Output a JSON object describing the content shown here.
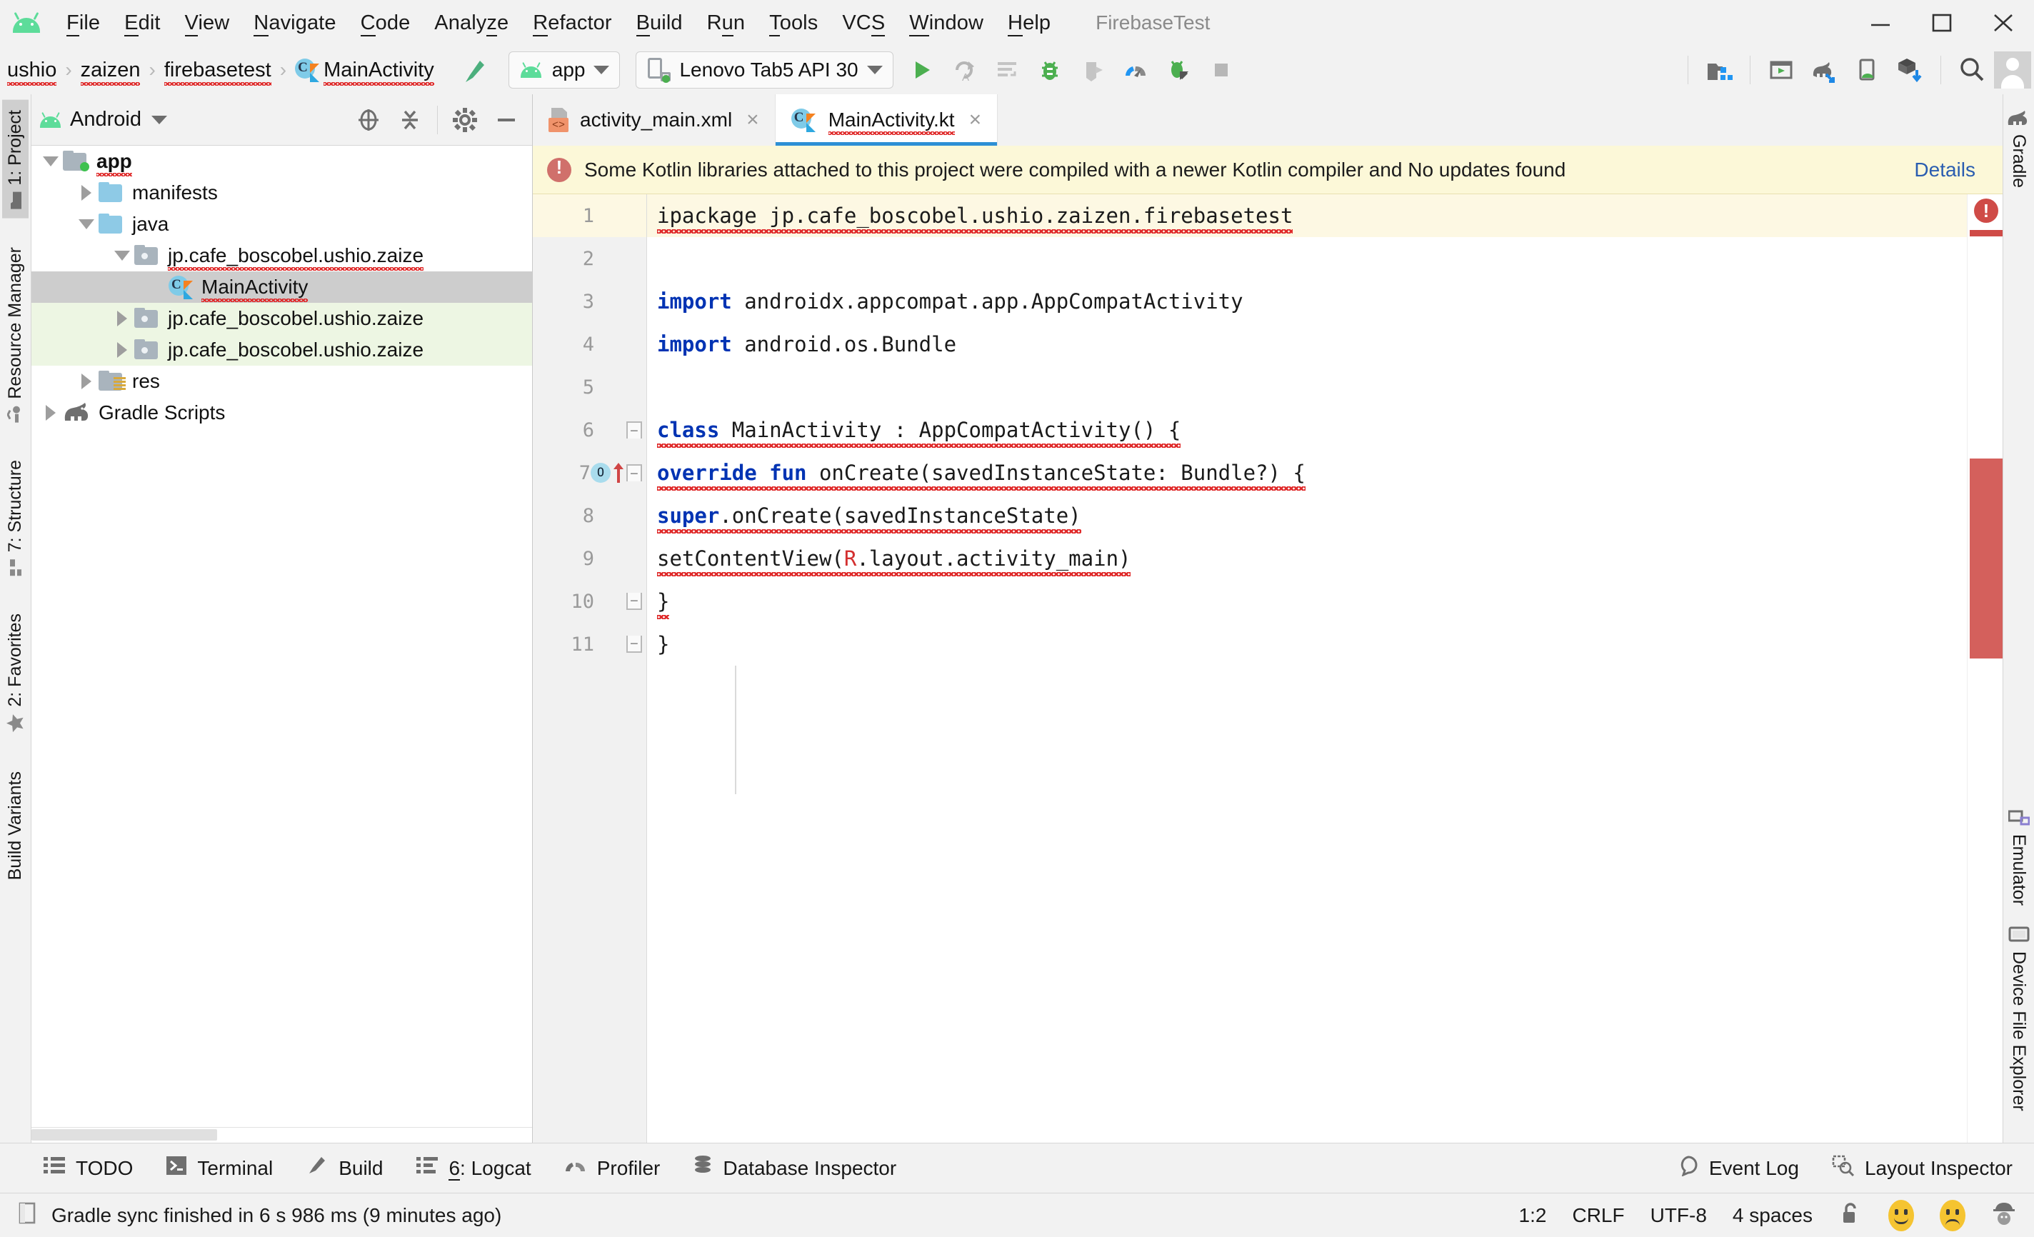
{
  "window": {
    "title": "FirebaseTest",
    "minimize_label": "Minimize",
    "maximize_label": "Maximize",
    "close_label": "Close"
  },
  "menu": {
    "items": [
      {
        "label": "File",
        "mnemonic": "F"
      },
      {
        "label": "Edit",
        "mnemonic": "E"
      },
      {
        "label": "View",
        "mnemonic": "V"
      },
      {
        "label": "Navigate",
        "mnemonic": "N"
      },
      {
        "label": "Code",
        "mnemonic": "C"
      },
      {
        "label": "Analyze",
        "mnemonic": "z"
      },
      {
        "label": "Refactor",
        "mnemonic": "R"
      },
      {
        "label": "Build",
        "mnemonic": "B"
      },
      {
        "label": "Run",
        "mnemonic": "u"
      },
      {
        "label": "Tools",
        "mnemonic": "T"
      },
      {
        "label": "VCS",
        "mnemonic": "S"
      },
      {
        "label": "Window",
        "mnemonic": "W"
      },
      {
        "label": "Help",
        "mnemonic": "H"
      }
    ]
  },
  "navbar": {
    "breadcrumbs": [
      "ushio",
      "zaizen",
      "firebasetest",
      "MainActivity"
    ],
    "separator": "›",
    "module_selector": "app",
    "device_selector": "Lenovo Tab5 API 30",
    "icons": [
      "make-project-icon",
      "run-icon",
      "apply-changes-icon",
      "apply-code-changes-icon",
      "debug-icon",
      "attach-debugger-icon",
      "profiler-icon",
      "debug-attach-icon",
      "stop-icon",
      "sdk-manager-icon",
      "avd-manager-icon",
      "gradle-sync-icon",
      "device-manager-icon",
      "install-module-icon",
      "search-icon",
      "avatar-icon"
    ]
  },
  "left_tool_strip": [
    {
      "label": "1: Project",
      "icon": "project-icon",
      "selected": true
    },
    {
      "label": "Resource Manager",
      "icon": "resource-manager-icon",
      "selected": false
    },
    {
      "label": "7: Structure",
      "icon": "structure-icon",
      "selected": false
    },
    {
      "label": "2: Favorites",
      "icon": "favorites-star-icon",
      "selected": false
    },
    {
      "label": "Build Variants",
      "icon": "build-variants-icon",
      "selected": false
    }
  ],
  "right_tool_strip": [
    {
      "label": "Gradle",
      "icon": "gradle-elephant-icon"
    },
    {
      "label": "Emulator",
      "icon": "emulator-icon"
    },
    {
      "label": "Device File Explorer",
      "icon": "device-file-explorer-icon"
    }
  ],
  "project_panel": {
    "title": "Android",
    "actions": [
      "select-opened-file-icon",
      "collapse-all-icon",
      "settings-gear-icon",
      "hide-icon"
    ],
    "tree": [
      {
        "label": "app",
        "icon": "module-folder-icon",
        "depth": 0,
        "expanded": true,
        "arrow": "down",
        "bold": true,
        "squiggly": true,
        "state": "normal"
      },
      {
        "label": "manifests",
        "icon": "folder-blue-icon",
        "depth": 1,
        "expanded": false,
        "arrow": "right",
        "bold": false,
        "squiggly": false,
        "state": "normal"
      },
      {
        "label": "java",
        "icon": "folder-blue-icon",
        "depth": 1,
        "expanded": true,
        "arrow": "down",
        "bold": false,
        "squiggly": false,
        "state": "normal"
      },
      {
        "label": "jp.cafe_boscobel.ushio.zaize",
        "icon": "package-folder-icon",
        "depth": 2,
        "expanded": true,
        "arrow": "down",
        "bold": false,
        "squiggly": true,
        "state": "normal"
      },
      {
        "label": "MainActivity",
        "icon": "kotlin-class-icon",
        "depth": 3,
        "expanded": false,
        "arrow": "none",
        "bold": false,
        "squiggly": true,
        "state": "selected"
      },
      {
        "label": "jp.cafe_boscobel.ushio.zaize",
        "icon": "package-folder-icon",
        "depth": 2,
        "expanded": false,
        "arrow": "right",
        "bold": false,
        "squiggly": false,
        "state": "test"
      },
      {
        "label": "jp.cafe_boscobel.ushio.zaize",
        "icon": "package-folder-icon",
        "depth": 2,
        "expanded": false,
        "arrow": "right",
        "bold": false,
        "squiggly": false,
        "state": "test"
      },
      {
        "label": "res",
        "icon": "res-folder-icon",
        "depth": 1,
        "expanded": false,
        "arrow": "right",
        "bold": false,
        "squiggly": false,
        "state": "normal"
      },
      {
        "label": "Gradle Scripts",
        "icon": "gradle-elephant-icon",
        "depth": 0,
        "expanded": false,
        "arrow": "right",
        "bold": false,
        "squiggly": false,
        "state": "normal"
      }
    ]
  },
  "editor": {
    "tabs": [
      {
        "label": "activity_main.xml",
        "icon": "xml-layout-icon",
        "active": false,
        "close": "×"
      },
      {
        "label": "MainActivity.kt",
        "icon": "kotlin-file-icon",
        "active": true,
        "close": "×"
      }
    ],
    "banner": {
      "message": "Some Kotlin libraries attached to this project were compiled with a newer Kotlin compiler and No updates found",
      "action": "Details",
      "icon": "error-circle-icon"
    },
    "code_lines": [
      {
        "num": "1",
        "text": "ipackage jp.cafe_boscobel.ushio.zaizen.firebasetest",
        "highlight": true,
        "squiggly": true,
        "tokens": [
          {
            "t": "ipackage jp.cafe_boscobel.ushio.zaizen.firebasetest",
            "c": "plain"
          }
        ]
      },
      {
        "num": "2",
        "text": "",
        "highlight": false,
        "squiggly": false,
        "tokens": []
      },
      {
        "num": "3",
        "text": "import androidx.appcompat.app.AppCompatActivity",
        "highlight": false,
        "squiggly": false,
        "tokens": [
          {
            "t": "import",
            "c": "kw"
          },
          {
            "t": " androidx.appcompat.app.AppCompatActivity",
            "c": "plain"
          }
        ]
      },
      {
        "num": "4",
        "text": "import android.os.Bundle",
        "highlight": false,
        "squiggly": false,
        "tokens": [
          {
            "t": "import",
            "c": "kw"
          },
          {
            "t": " android.os.Bundle",
            "c": "plain"
          }
        ]
      },
      {
        "num": "5",
        "text": "",
        "highlight": false,
        "squiggly": false,
        "tokens": []
      },
      {
        "num": "6",
        "text": "class MainActivity : AppCompatActivity() {",
        "highlight": false,
        "squiggly": true,
        "tokens": [
          {
            "t": "class",
            "c": "kw"
          },
          {
            "t": " MainActivity : AppCompatActivity() {",
            "c": "plain"
          }
        ]
      },
      {
        "num": "7",
        "text": "    override fun onCreate(savedInstanceState: Bundle?) {",
        "highlight": false,
        "squiggly": true,
        "tokens": [
          {
            "t": "    ",
            "c": "plain"
          },
          {
            "t": "override fun",
            "c": "kw"
          },
          {
            "t": " onCreate(savedInstanceState: Bundle?) {",
            "c": "plain"
          }
        ]
      },
      {
        "num": "8",
        "text": "        super.onCreate(savedInstanceState)",
        "highlight": false,
        "squiggly": true,
        "tokens": [
          {
            "t": "        ",
            "c": "plain"
          },
          {
            "t": "super",
            "c": "kw"
          },
          {
            "t": ".onCreate(savedInstanceState)",
            "c": "plain"
          }
        ]
      },
      {
        "num": "9",
        "text": "        setContentView(R.layout.activity_main)",
        "highlight": false,
        "squiggly": true,
        "tokens": [
          {
            "t": "        setContentView(",
            "c": "plain"
          },
          {
            "t": "R",
            "c": "rref"
          },
          {
            "t": ".layout.activity_main)",
            "c": "plain"
          }
        ]
      },
      {
        "num": "10",
        "text": "    }",
        "highlight": false,
        "squiggly": true,
        "tokens": [
          {
            "t": "    }",
            "c": "plain"
          }
        ]
      },
      {
        "num": "11",
        "text": "}",
        "highlight": false,
        "squiggly": false,
        "tokens": [
          {
            "t": "}",
            "c": "plain"
          }
        ]
      }
    ]
  },
  "bottom_tool_windows": {
    "left": [
      {
        "label": "TODO",
        "icon": "todo-icon",
        "mnemonic": ""
      },
      {
        "label": "Terminal",
        "icon": "terminal-icon",
        "mnemonic": ""
      },
      {
        "label": "Build",
        "icon": "build-hammer-icon",
        "mnemonic": ""
      },
      {
        "label": "6: Logcat",
        "icon": "logcat-icon",
        "mnemonic": "6"
      },
      {
        "label": "Profiler",
        "icon": "profiler-icon",
        "mnemonic": ""
      },
      {
        "label": "Database Inspector",
        "icon": "database-icon",
        "mnemonic": ""
      }
    ],
    "right": [
      {
        "label": "Event Log",
        "icon": "event-log-icon"
      },
      {
        "label": "Layout Inspector",
        "icon": "layout-inspector-icon"
      }
    ]
  },
  "status_bar": {
    "message": "Gradle sync finished in 6 s 986 ms (9 minutes ago)",
    "message_icon": "status-doc-icon",
    "caret_position": "1:2",
    "line_separator": "CRLF",
    "encoding": "UTF-8",
    "indent": "4 spaces",
    "lock_icon": "unlocked-icon",
    "happy_icon": "happy-face-icon",
    "sad_icon": "sad-face-icon",
    "inspector_icon": "detective-icon"
  },
  "colors": {
    "android_green": "#5ddc9a",
    "accent_blue": "#2d8fd5",
    "error_red": "#cf4b47",
    "banner_bg": "#fcf8d8",
    "selection_gray": "#cdcdcd",
    "test_source_green": "#edf6e3",
    "keyword_blue": "#0033b3",
    "link_blue": "#2a5db0"
  }
}
